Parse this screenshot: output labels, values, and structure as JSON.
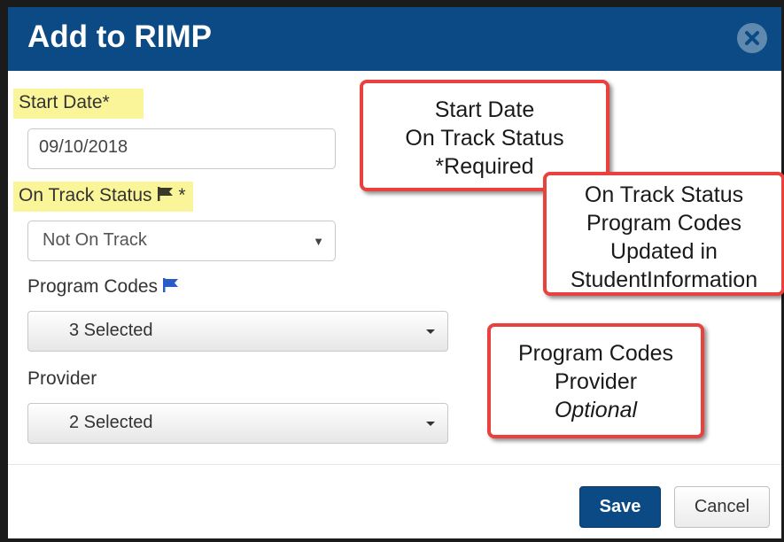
{
  "dialog": {
    "title": "Add to RIMP",
    "close_icon": "circle-x-icon"
  },
  "form": {
    "start_date": {
      "label": "Start Date*",
      "value": "09/10/2018"
    },
    "on_track_status": {
      "label": "On Track Status",
      "required_mark": "*",
      "flag_icon": "flag-icon",
      "value": "Not On Track",
      "caret": "▼"
    },
    "program_codes": {
      "label": "Program Codes",
      "flag_icon": "flag-icon",
      "value": "3 Selected"
    },
    "provider": {
      "label": "Provider",
      "value": "2 Selected"
    }
  },
  "footer": {
    "save_label": "Save",
    "cancel_label": "Cancel"
  },
  "callouts": [
    {
      "lines": [
        "Start Date",
        "On Track Status",
        "*Required"
      ]
    },
    {
      "lines": [
        "On Track Status",
        "Program Codes",
        "Updated in",
        "StudentInformation"
      ]
    },
    {
      "lines": [
        "Program Codes",
        "Provider",
        "Optional"
      ]
    }
  ],
  "colors": {
    "header": "#0b4a85",
    "highlight": "#fbf59a",
    "callout_border": "#e8413e",
    "flag_dark": "#3a3a2a",
    "flag_blue": "#2a5cc8"
  }
}
